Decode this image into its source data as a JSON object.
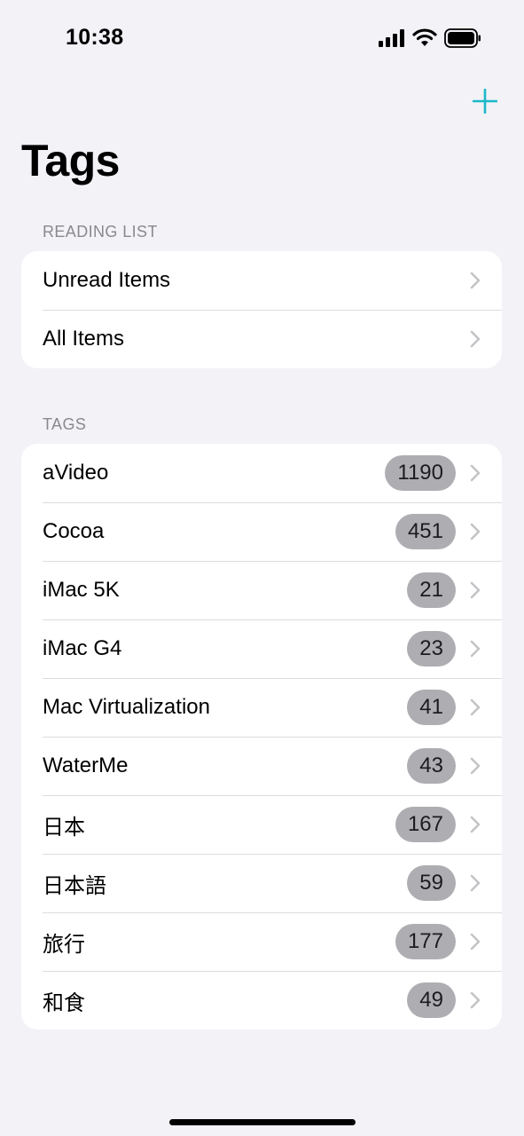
{
  "status_bar": {
    "time": "10:38"
  },
  "colors": {
    "accent": "#1cb8c9",
    "background": "#f2f2f7",
    "badge": "#aeaeb2"
  },
  "nav": {
    "title": "Tags",
    "add_icon": "plus-icon"
  },
  "reading_list": {
    "header": "READING LIST",
    "items": [
      {
        "label": "Unread Items"
      },
      {
        "label": "All Items"
      }
    ]
  },
  "tags": {
    "header": "TAGS",
    "items": [
      {
        "label": "aVideo",
        "count": "1190"
      },
      {
        "label": "Cocoa",
        "count": "451"
      },
      {
        "label": "iMac 5K",
        "count": "21"
      },
      {
        "label": "iMac G4",
        "count": "23"
      },
      {
        "label": "Mac Virtualization",
        "count": "41"
      },
      {
        "label": "WaterMe",
        "count": "43"
      },
      {
        "label": "日本",
        "count": "167"
      },
      {
        "label": "日本語",
        "count": "59"
      },
      {
        "label": "旅行",
        "count": "177"
      },
      {
        "label": "和食",
        "count": "49"
      }
    ]
  }
}
